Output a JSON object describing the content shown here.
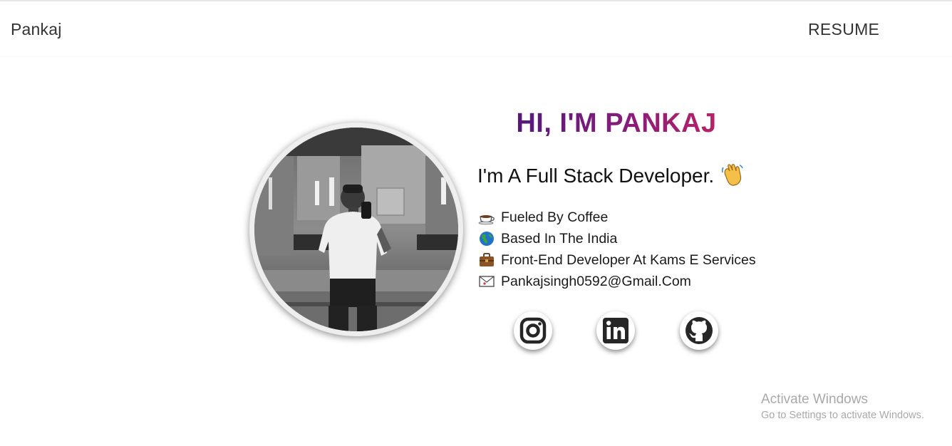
{
  "navbar": {
    "brand": "Pankaj",
    "resume_label": "RESUME"
  },
  "hero": {
    "greeting": "HI, I'M PANKAJ",
    "tagline": "I'm A Full Stack Developer.",
    "tagline_emoji": "waving-hand-icon",
    "facts": [
      {
        "icon": "coffee-cup-icon",
        "text": "Fueled By Coffee"
      },
      {
        "icon": "globe-icon",
        "text": "Based In The India"
      },
      {
        "icon": "briefcase-icon",
        "text": "Front-End Developer At Kams E Services"
      },
      {
        "icon": "envelope-icon",
        "text": "Pankajsingh0592@Gmail.Com"
      }
    ]
  },
  "social": [
    {
      "icon": "instagram-icon"
    },
    {
      "icon": "linkedin-icon"
    },
    {
      "icon": "github-icon"
    }
  ],
  "watermark": {
    "title": "Activate Windows",
    "subtitle": "Go to Settings to activate Windows."
  },
  "colors": {
    "greeting_gradient": [
      "#3d1a78",
      "#8a1c7c",
      "#d3245a"
    ],
    "text": "#1a1a1a",
    "watermark": "#a9a9a9"
  }
}
